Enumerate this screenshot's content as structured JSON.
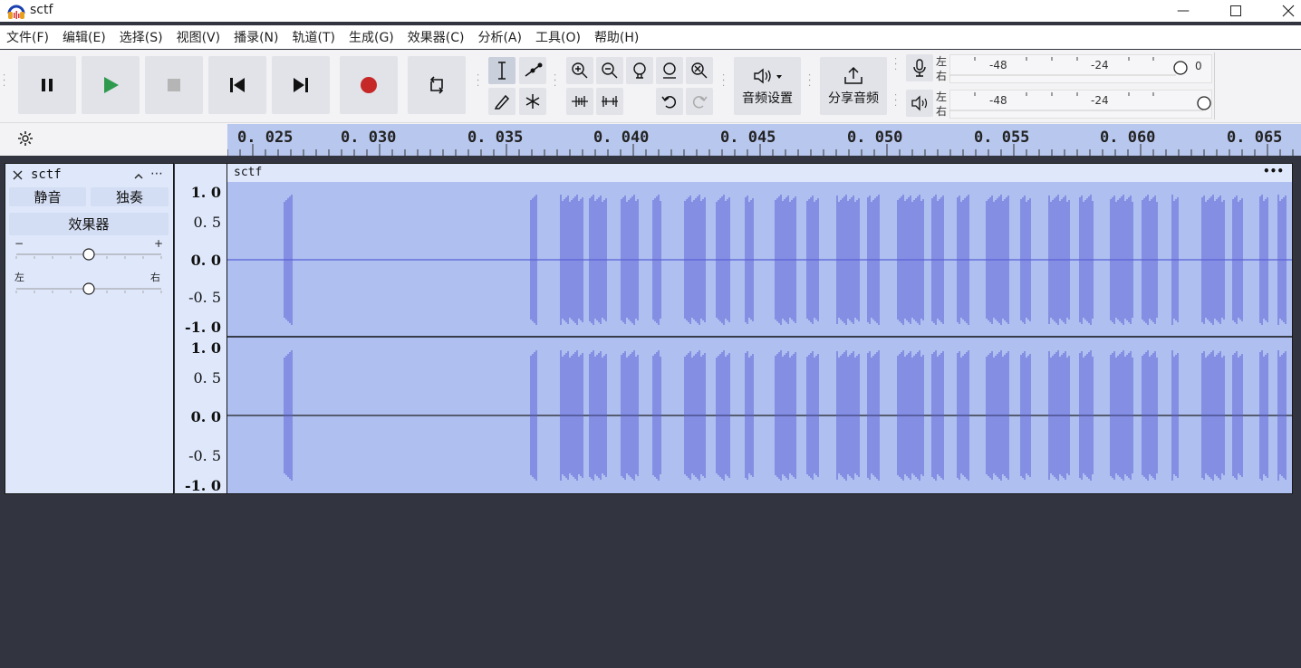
{
  "window": {
    "title": "sctf"
  },
  "menu": [
    "文件(F)",
    "编辑(E)",
    "选择(S)",
    "视图(V)",
    "播录(N)",
    "轨道(T)",
    "生成(G)",
    "效果器(C)",
    "分析(A)",
    "工具(O)",
    "帮助(H)"
  ],
  "toolbar": {
    "audio_setup_label": "音频设置",
    "share_audio_label": "分享音频",
    "meter": {
      "left_label": "左",
      "right_label": "右",
      "tick_minus48": "-48",
      "tick_minus24": "-24",
      "record_end_value": "0"
    }
  },
  "ruler": {
    "ticks": [
      "0. 025",
      "0. 030",
      "0. 035",
      "0. 040",
      "0. 045",
      "0. 050",
      "0. 055",
      "0. 060",
      "0. 065"
    ]
  },
  "track": {
    "name": "sctf",
    "mute_label": "静音",
    "solo_label": "独奏",
    "effects_label": "效果器",
    "gain_minus": "−",
    "gain_plus": "+",
    "pan_left": "左",
    "pan_right": "右",
    "gain_value": 0.5,
    "pan_value": 0.5
  },
  "clip": {
    "name": "sctf",
    "menu_label": "•••"
  },
  "yaxis": {
    "channel1": [
      "1. 0",
      "0. 5",
      "0. 0",
      "-0. 5",
      "-1. 0"
    ],
    "channel2": [
      "1. 0",
      "0. 5",
      "0. 0",
      "-0. 5",
      "-1. 0"
    ]
  },
  "colors": {
    "waveform": "#5a5fd6",
    "clip_bg": "#aebff0",
    "track_bg": "#dfe8fb",
    "record": "#c62828",
    "play": "#2e9a4e"
  }
}
